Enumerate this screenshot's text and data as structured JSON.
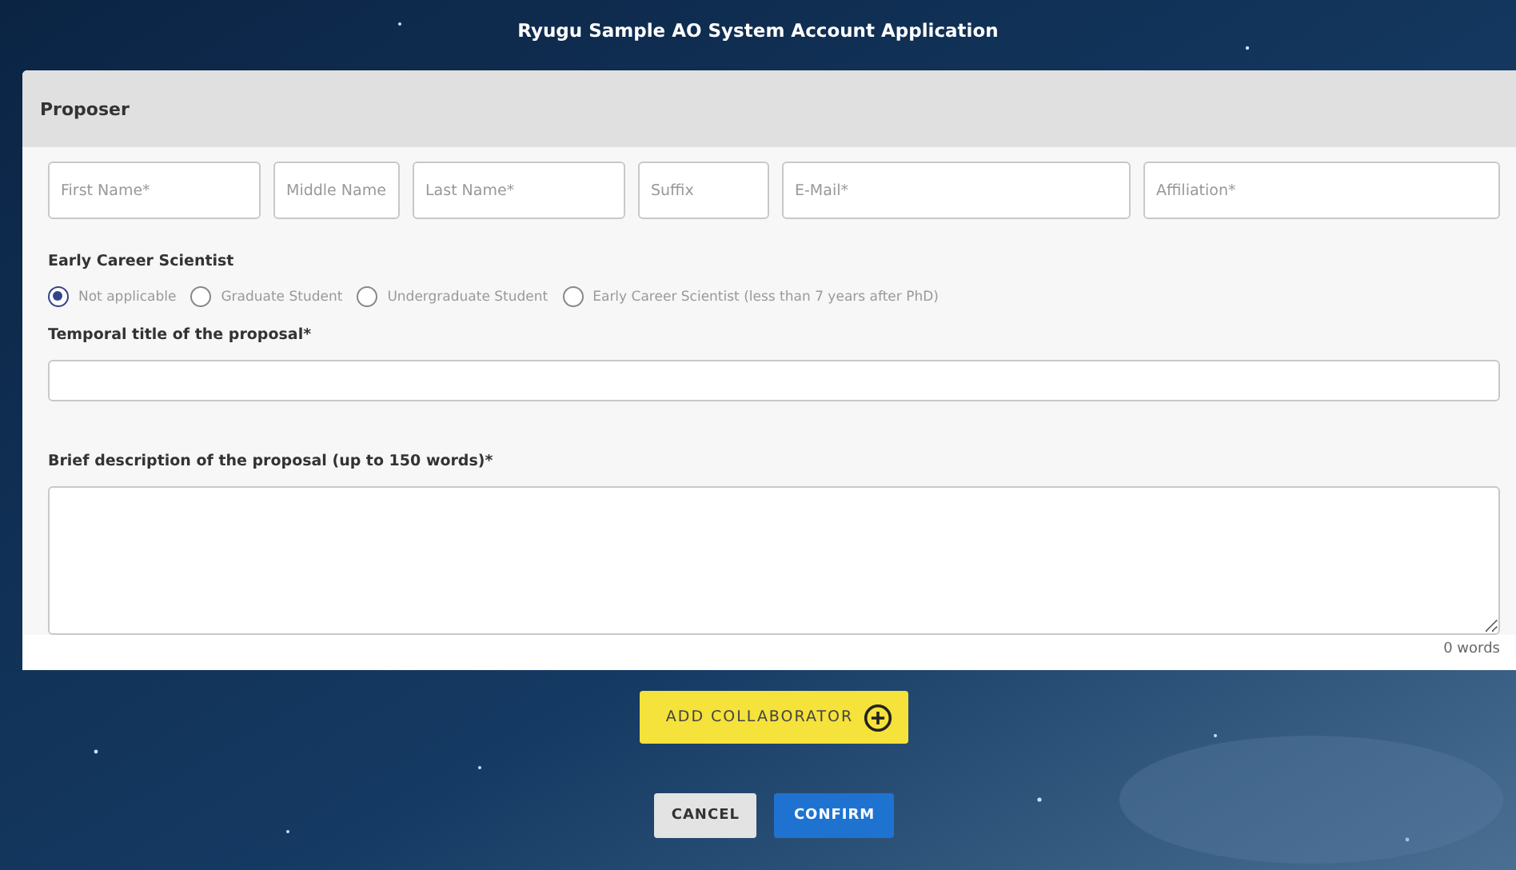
{
  "title": "Ryugu Sample AO System Account Application",
  "section": {
    "heading": "Proposer"
  },
  "name_fields": [
    {
      "placeholder": "First Name*"
    },
    {
      "placeholder": "Middle Name"
    },
    {
      "placeholder": "Last Name*"
    },
    {
      "placeholder": "Suffix"
    },
    {
      "placeholder": "E-Mail*"
    },
    {
      "placeholder": "Affiliation*"
    }
  ],
  "career": {
    "label": "Early Career Scientist",
    "options": [
      {
        "label": "Not applicable",
        "selected": true
      },
      {
        "label": "Graduate Student",
        "selected": false
      },
      {
        "label": "Undergraduate Student",
        "selected": false
      },
      {
        "label": "Early Career Scientist (less than 7 years after PhD)",
        "selected": false
      }
    ]
  },
  "proposal_title": {
    "label": "Temporal title of the proposal*"
  },
  "description": {
    "label": "Brief description of the proposal (up to 150 words)*",
    "word_count": "0 words"
  },
  "add_button": {
    "label": "ADD COLLABORATOR"
  },
  "buttons": [
    {
      "label": "CANCEL",
      "kind": "secondary"
    },
    {
      "label": "CONFIRM",
      "kind": "primary"
    }
  ]
}
